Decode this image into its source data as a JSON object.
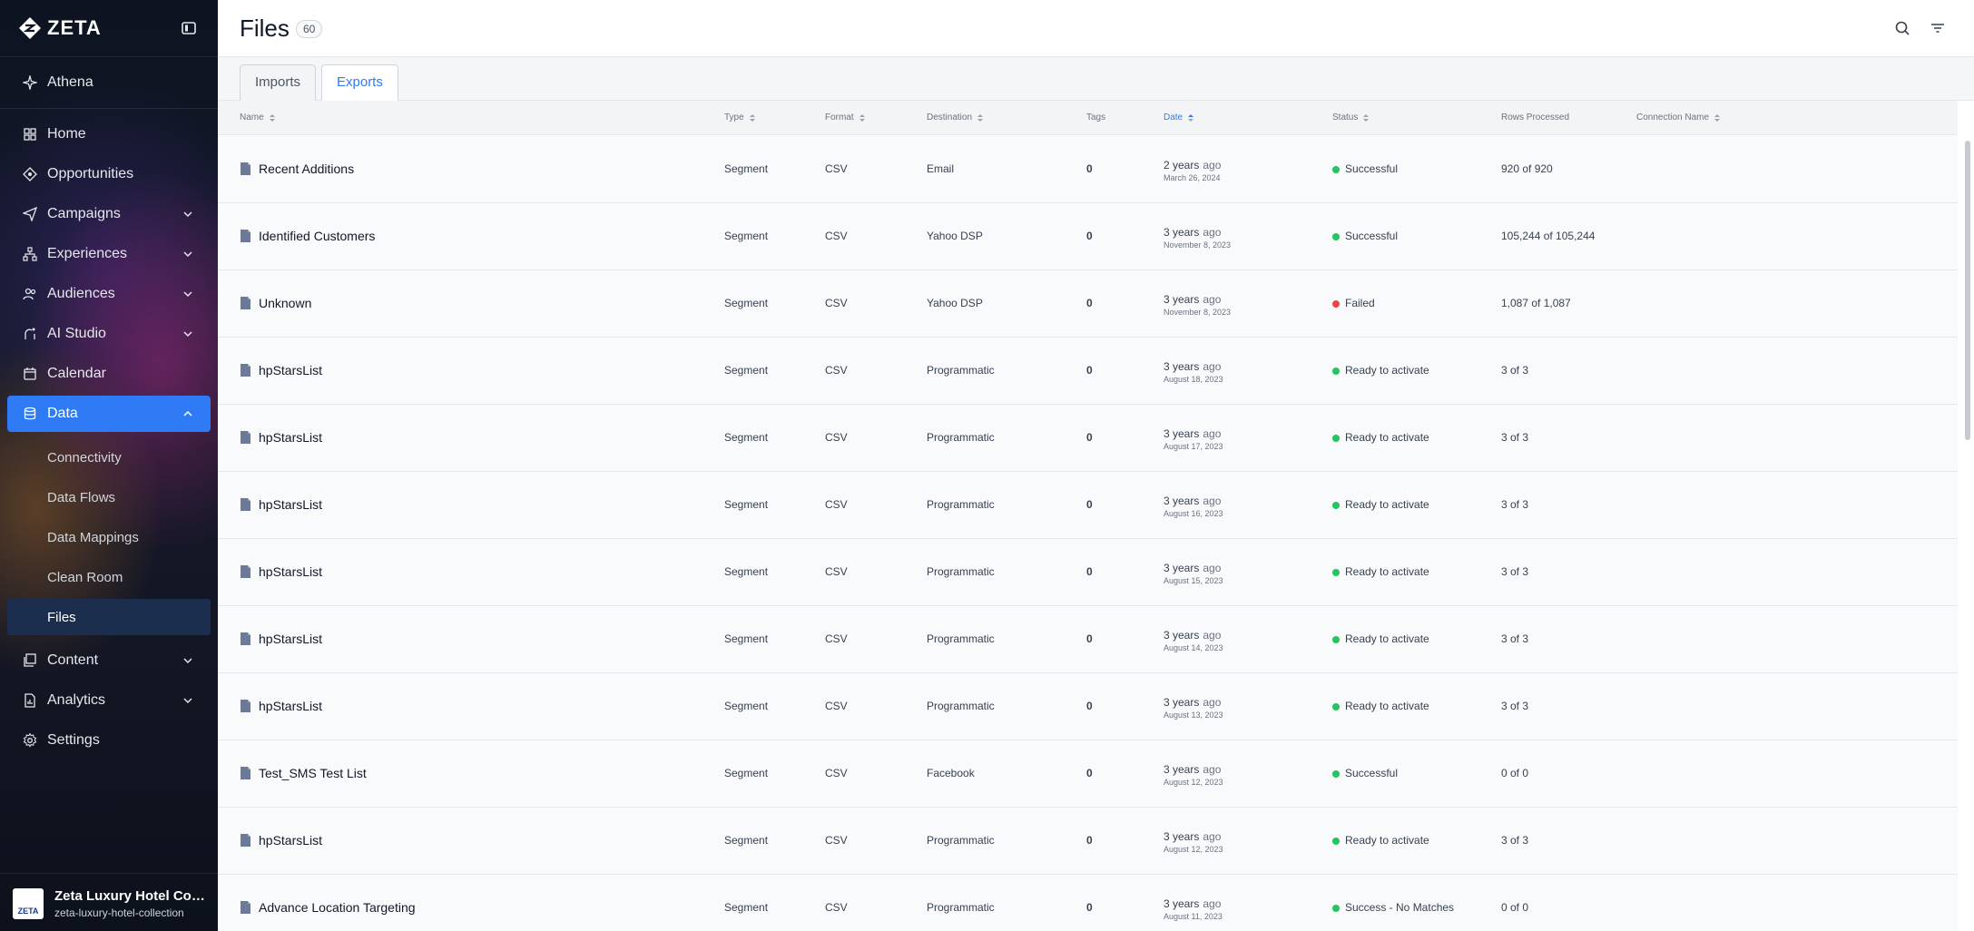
{
  "app": {
    "brand": "ZETA",
    "logo_icon": "zeta-diamond-logo"
  },
  "sidebar": {
    "athena_label": "Athena",
    "items": [
      {
        "label": "Home",
        "icon": "home-grid-icon"
      },
      {
        "label": "Opportunities",
        "icon": "opportunities-icon"
      },
      {
        "label": "Campaigns",
        "icon": "send-icon"
      },
      {
        "label": "Experiences",
        "icon": "hierarchy-icon"
      },
      {
        "label": "Audiences",
        "icon": "people-icon"
      },
      {
        "label": "AI Studio",
        "icon": "ai-studio-icon"
      },
      {
        "label": "Calendar",
        "icon": "calendar-icon"
      },
      {
        "label": "Data",
        "icon": "database-icon"
      },
      {
        "label": "Content",
        "icon": "content-icon"
      },
      {
        "label": "Analytics",
        "icon": "analytics-icon"
      },
      {
        "label": "Settings",
        "icon": "gear-icon"
      }
    ],
    "data_subitems": [
      "Connectivity",
      "Data Flows",
      "Data Mappings",
      "Clean Room",
      "Files"
    ],
    "active_item": "Data",
    "active_subitem": "Files"
  },
  "org": {
    "avatar_text": "ZETA",
    "name": "Zeta Luxury Hotel Colle...",
    "slug": "zeta-luxury-hotel-collection"
  },
  "header": {
    "title": "Files",
    "count": "60"
  },
  "tabs": [
    {
      "label": "Imports"
    },
    {
      "label": "Exports"
    }
  ],
  "active_tab": "Exports",
  "table": {
    "columns": {
      "name": "Name",
      "type": "Type",
      "format": "Format",
      "destination": "Destination",
      "tags": "Tags",
      "date": "Date",
      "status": "Status",
      "rows_processed": "Rows Processed",
      "connection_name": "Connection Name"
    },
    "status_colors": {
      "success": "#22c55e",
      "failed": "#ef4444"
    },
    "rows": [
      {
        "name": "Recent Additions",
        "type": "Segment",
        "format": "CSV",
        "destination": "Email",
        "tags": "0",
        "date_relative": "2 years",
        "ago": "ago",
        "date": "March 26, 2024",
        "status": "Successful",
        "status_kind": "success",
        "rows_processed": "920 of 920"
      },
      {
        "name": "Identified Customers",
        "type": "Segment",
        "format": "CSV",
        "destination": "Yahoo DSP",
        "tags": "0",
        "date_relative": "3 years",
        "ago": "ago",
        "date": "November 8, 2023",
        "status": "Successful",
        "status_kind": "success",
        "rows_processed": "105,244 of 105,244"
      },
      {
        "name": "Unknown",
        "type": "Segment",
        "format": "CSV",
        "destination": "Yahoo DSP",
        "tags": "0",
        "date_relative": "3 years",
        "ago": "ago",
        "date": "November 8, 2023",
        "status": "Failed",
        "status_kind": "failed",
        "rows_processed": "1,087 of 1,087"
      },
      {
        "name": "hpStarsList",
        "type": "Segment",
        "format": "CSV",
        "destination": "Programmatic",
        "tags": "0",
        "date_relative": "3 years",
        "ago": "ago",
        "date": "August 18, 2023",
        "status": "Ready to activate",
        "status_kind": "success",
        "rows_processed": "3 of 3"
      },
      {
        "name": "hpStarsList",
        "type": "Segment",
        "format": "CSV",
        "destination": "Programmatic",
        "tags": "0",
        "date_relative": "3 years",
        "ago": "ago",
        "date": "August 17, 2023",
        "status": "Ready to activate",
        "status_kind": "success",
        "rows_processed": "3 of 3"
      },
      {
        "name": "hpStarsList",
        "type": "Segment",
        "format": "CSV",
        "destination": "Programmatic",
        "tags": "0",
        "date_relative": "3 years",
        "ago": "ago",
        "date": "August 16, 2023",
        "status": "Ready to activate",
        "status_kind": "success",
        "rows_processed": "3 of 3"
      },
      {
        "name": "hpStarsList",
        "type": "Segment",
        "format": "CSV",
        "destination": "Programmatic",
        "tags": "0",
        "date_relative": "3 years",
        "ago": "ago",
        "date": "August 15, 2023",
        "status": "Ready to activate",
        "status_kind": "success",
        "rows_processed": "3 of 3"
      },
      {
        "name": "hpStarsList",
        "type": "Segment",
        "format": "CSV",
        "destination": "Programmatic",
        "tags": "0",
        "date_relative": "3 years",
        "ago": "ago",
        "date": "August 14, 2023",
        "status": "Ready to activate",
        "status_kind": "success",
        "rows_processed": "3 of 3"
      },
      {
        "name": "hpStarsList",
        "type": "Segment",
        "format": "CSV",
        "destination": "Programmatic",
        "tags": "0",
        "date_relative": "3 years",
        "ago": "ago",
        "date": "August 13, 2023",
        "status": "Ready to activate",
        "status_kind": "success",
        "rows_processed": "3 of 3"
      },
      {
        "name": "Test_SMS Test List",
        "type": "Segment",
        "format": "CSV",
        "destination": "Facebook",
        "tags": "0",
        "date_relative": "3 years",
        "ago": "ago",
        "date": "August 12, 2023",
        "status": "Successful",
        "status_kind": "success",
        "rows_processed": "0 of 0"
      },
      {
        "name": "hpStarsList",
        "type": "Segment",
        "format": "CSV",
        "destination": "Programmatic",
        "tags": "0",
        "date_relative": "3 years",
        "ago": "ago",
        "date": "August 12, 2023",
        "status": "Ready to activate",
        "status_kind": "success",
        "rows_processed": "3 of 3"
      },
      {
        "name": "Advance Location Targeting",
        "type": "Segment",
        "format": "CSV",
        "destination": "Programmatic",
        "tags": "0",
        "date_relative": "3 years",
        "ago": "ago",
        "date": "August 11, 2023",
        "status": "Success - No Matches",
        "status_kind": "success",
        "rows_processed": "0 of 0"
      }
    ]
  }
}
